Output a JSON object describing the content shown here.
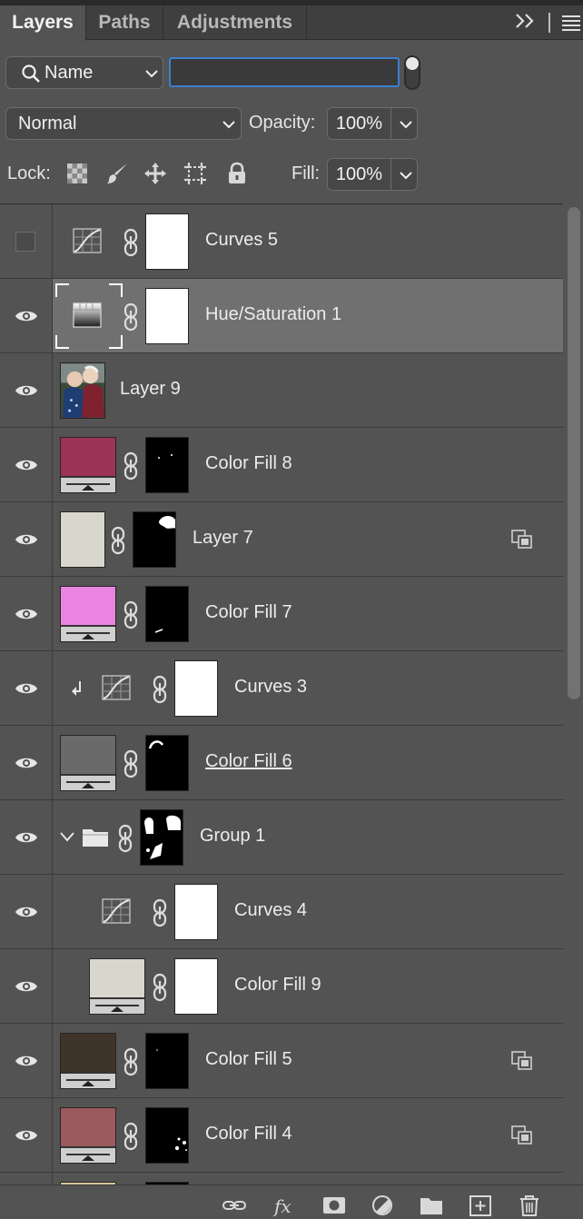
{
  "tabs": [
    {
      "label": "Layers",
      "active": true
    },
    {
      "label": "Paths",
      "active": false
    },
    {
      "label": "Adjustments",
      "active": false
    }
  ],
  "filter": {
    "kind": "Name",
    "search_value": ""
  },
  "blend_mode": "Normal",
  "opacity": {
    "label": "Opacity:",
    "value": "100%"
  },
  "lock": {
    "label": "Lock:"
  },
  "fill": {
    "label": "Fill:",
    "value": "100%"
  },
  "layers": [
    {
      "name": "Curves 5",
      "visible": false,
      "type": "curves"
    },
    {
      "name": "Hue/Saturation 1",
      "visible": true,
      "type": "hue-saturation",
      "selected": true
    },
    {
      "name": "Layer 9",
      "visible": true,
      "type": "photo"
    },
    {
      "name": "Color Fill 8",
      "visible": true,
      "type": "color-fill",
      "color": "#9b3357"
    },
    {
      "name": "Layer 7",
      "visible": true,
      "type": "pixel",
      "color": "#d8d7cd"
    },
    {
      "name": "Color Fill 7",
      "visible": true,
      "type": "color-fill",
      "color": "#e985e0"
    },
    {
      "name": "Curves 3",
      "visible": true,
      "type": "curves",
      "clipped": true
    },
    {
      "name": "Color Fill 6",
      "visible": true,
      "type": "color-fill",
      "color": "#6a6a6a",
      "underline": true
    },
    {
      "name": "Group 1",
      "visible": true,
      "type": "group",
      "expanded": true
    },
    {
      "name": "Curves 4",
      "visible": true,
      "type": "curves",
      "indent": true
    },
    {
      "name": "Color Fill 9",
      "visible": true,
      "type": "color-fill",
      "color": "#d9d6cc",
      "indent": true
    },
    {
      "name": "Color Fill 5",
      "visible": true,
      "type": "color-fill",
      "color": "#3f3429"
    },
    {
      "name": "Color Fill 4",
      "visible": true,
      "type": "color-fill",
      "color": "#9b5a5d"
    }
  ],
  "partial_layer": {
    "color": "#d9c69a"
  }
}
